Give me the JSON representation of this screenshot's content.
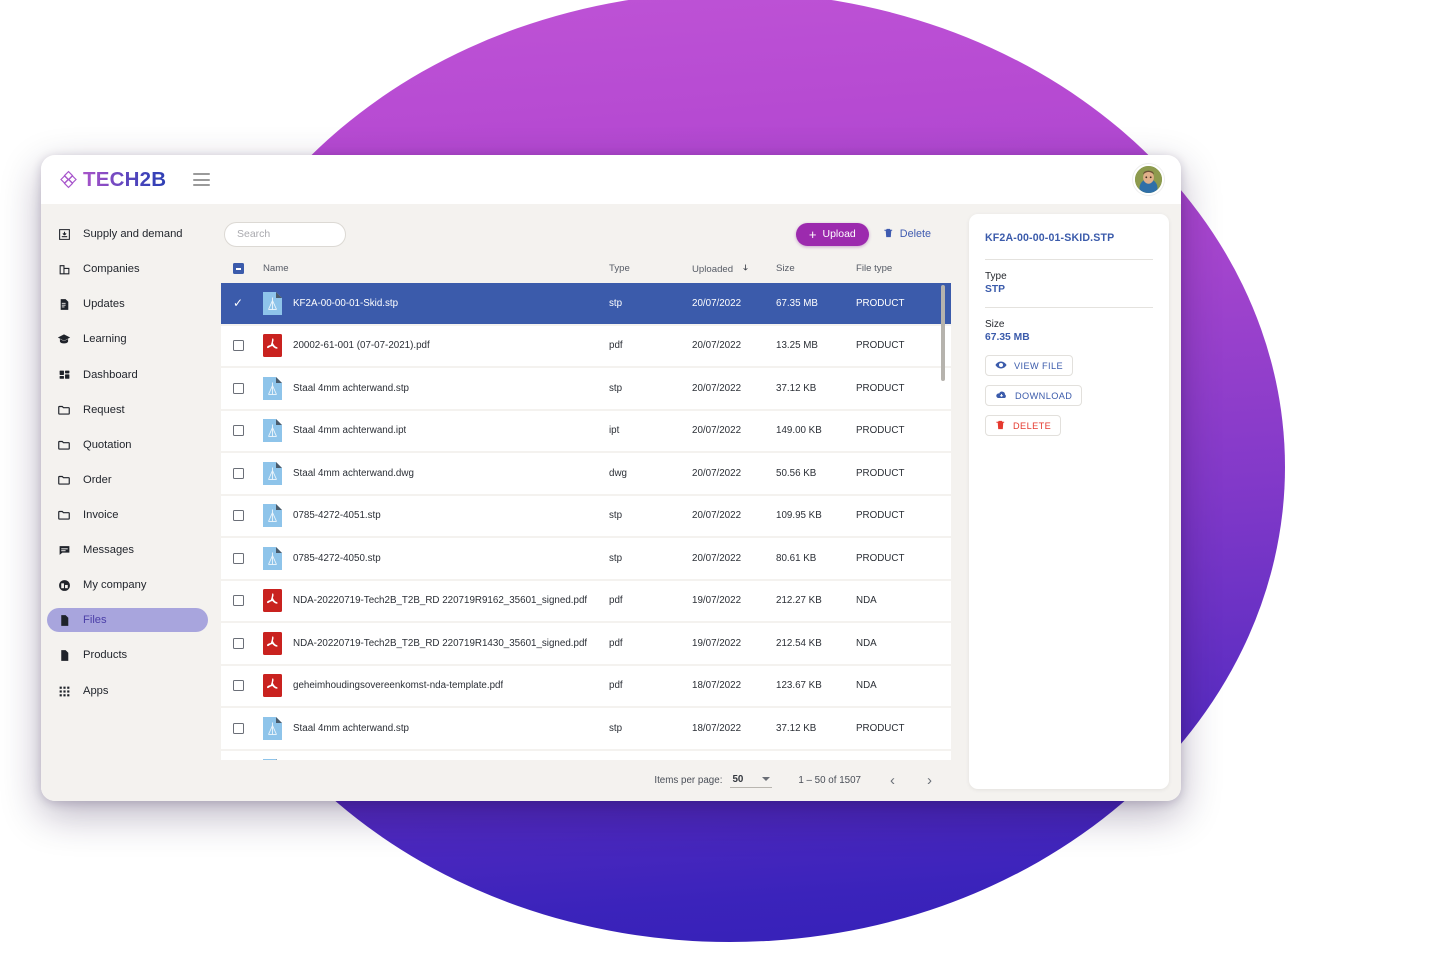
{
  "brand": {
    "name": "TECH2B",
    "logo_icon": "diamond-lattice-logo",
    "menu_icon": "hamburger-menu-icon",
    "avatar_icon": "user-avatar"
  },
  "colors": {
    "accent_purple": "#9c2aae",
    "accent_blue": "#3b5bab",
    "sidebar_active_bg": "#a8a5dd",
    "sidebar_active_text": "#4b3fa8",
    "danger_red": "#e5392f",
    "blob_top": "#bf54d6",
    "blob_bottom": "#3521b7",
    "window_bg": "#f4f2ef"
  },
  "sidebar": {
    "groups": [
      {
        "items": [
          {
            "label": "Supply and demand",
            "icon": "inbox-icon",
            "active": false
          },
          {
            "label": "Companies",
            "icon": "building-icon",
            "active": false
          },
          {
            "label": "Updates",
            "icon": "article-icon",
            "active": false
          },
          {
            "label": "Learning",
            "icon": "graduation-cap-icon",
            "active": false
          }
        ]
      },
      {
        "items": [
          {
            "label": "Dashboard",
            "icon": "dashboard-grid-icon",
            "active": false
          },
          {
            "label": "Request",
            "icon": "folder-icon",
            "active": false
          },
          {
            "label": "Quotation",
            "icon": "folder-icon",
            "active": false
          },
          {
            "label": "Order",
            "icon": "folder-icon",
            "active": false
          },
          {
            "label": "Invoice",
            "icon": "folder-icon",
            "active": false
          },
          {
            "label": "Messages",
            "icon": "chat-bubble-icon",
            "active": false
          },
          {
            "label": "My company",
            "icon": "company-badge-icon",
            "active": false
          },
          {
            "label": "Files",
            "icon": "file-icon",
            "active": true
          },
          {
            "label": "Products",
            "icon": "file-icon",
            "active": false
          }
        ]
      },
      {
        "items": [
          {
            "label": "Apps",
            "icon": "apps-grid-icon",
            "active": false
          }
        ]
      }
    ]
  },
  "toolbar": {
    "search_placeholder": "Search",
    "search_value": "",
    "upload_label": "Upload",
    "upload_icon": "plus-icon",
    "delete_label": "Delete",
    "delete_icon": "trash-icon"
  },
  "table": {
    "select_all_state": "indeterminate",
    "columns": [
      {
        "key": "name",
        "label": "Name"
      },
      {
        "key": "type",
        "label": "Type"
      },
      {
        "key": "uploaded",
        "label": "Uploaded",
        "sorted": true,
        "sort_icon": "arrow-down-icon"
      },
      {
        "key": "size",
        "label": "Size"
      },
      {
        "key": "filetype",
        "label": "File type"
      }
    ],
    "rows": [
      {
        "name": "KF2A-00-00-01-Skid.stp",
        "type": "stp",
        "uploaded": "20/07/2022",
        "size": "67.35 MB",
        "filetype": "PRODUCT",
        "icon": "cad-file-icon",
        "selected": true
      },
      {
        "name": "20002-61-001 (07-07-2021).pdf",
        "type": "pdf",
        "uploaded": "20/07/2022",
        "size": "13.25 MB",
        "filetype": "PRODUCT",
        "icon": "pdf-file-icon",
        "selected": false
      },
      {
        "name": "Staal 4mm achterwand.stp",
        "type": "stp",
        "uploaded": "20/07/2022",
        "size": "37.12 KB",
        "filetype": "PRODUCT",
        "icon": "cad-file-icon",
        "selected": false
      },
      {
        "name": "Staal 4mm achterwand.ipt",
        "type": "ipt",
        "uploaded": "20/07/2022",
        "size": "149.00 KB",
        "filetype": "PRODUCT",
        "icon": "cad-file-icon",
        "selected": false
      },
      {
        "name": "Staal 4mm achterwand.dwg",
        "type": "dwg",
        "uploaded": "20/07/2022",
        "size": "50.56 KB",
        "filetype": "PRODUCT",
        "icon": "cad-file-icon",
        "selected": false
      },
      {
        "name": "0785-4272-4051.stp",
        "type": "stp",
        "uploaded": "20/07/2022",
        "size": "109.95 KB",
        "filetype": "PRODUCT",
        "icon": "cad-file-icon",
        "selected": false
      },
      {
        "name": "0785-4272-4050.stp",
        "type": "stp",
        "uploaded": "20/07/2022",
        "size": "80.61 KB",
        "filetype": "PRODUCT",
        "icon": "cad-file-icon",
        "selected": false
      },
      {
        "name": "NDA-20220719-Tech2B_T2B_RD 220719R9162_35601_signed.pdf",
        "type": "pdf",
        "uploaded": "19/07/2022",
        "size": "212.27 KB",
        "filetype": "NDA",
        "icon": "pdf-file-icon",
        "selected": false
      },
      {
        "name": "NDA-20220719-Tech2B_T2B_RD 220719R1430_35601_signed.pdf",
        "type": "pdf",
        "uploaded": "19/07/2022",
        "size": "212.54 KB",
        "filetype": "NDA",
        "icon": "pdf-file-icon",
        "selected": false
      },
      {
        "name": "geheimhoudingsovereenkomst-nda-template.pdf",
        "type": "pdf",
        "uploaded": "18/07/2022",
        "size": "123.67 KB",
        "filetype": "NDA",
        "icon": "pdf-file-icon",
        "selected": false
      },
      {
        "name": "Staal 4mm achterwand.stp",
        "type": "stp",
        "uploaded": "18/07/2022",
        "size": "37.12 KB",
        "filetype": "PRODUCT",
        "icon": "cad-file-icon",
        "selected": false
      },
      {
        "name": "",
        "type": "",
        "uploaded": "",
        "size": "",
        "filetype": "",
        "icon": "cad-file-icon",
        "selected": false
      }
    ]
  },
  "footer": {
    "items_per_page_label": "Items per page:",
    "items_per_page_value": "50",
    "range_label": "1 – 50 of 1507",
    "prev_icon": "chevron-left-icon",
    "next_icon": "chevron-right-icon"
  },
  "detail": {
    "title": "KF2A-00-00-01-SKID.STP",
    "fields": [
      {
        "label": "Type",
        "value": "STP"
      },
      {
        "label": "Size",
        "value": "67.35 MB"
      }
    ],
    "actions": [
      {
        "label": "VIEW FILE",
        "icon": "eye-icon",
        "style": "normal"
      },
      {
        "label": "DOWNLOAD",
        "icon": "cloud-download-icon",
        "style": "normal"
      },
      {
        "label": "DELETE",
        "icon": "trash-icon",
        "style": "danger"
      }
    ]
  }
}
